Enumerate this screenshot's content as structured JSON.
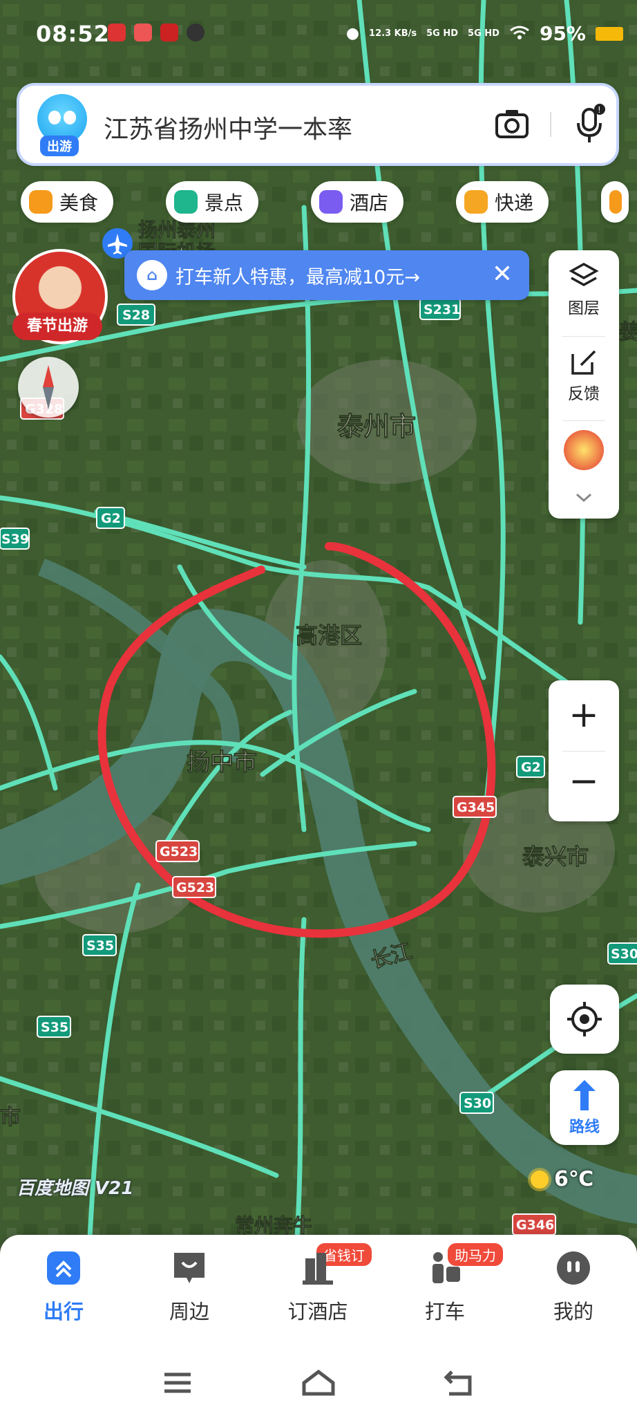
{
  "status_bar": {
    "time": "08:52",
    "network_speed": "12.3 KB/s",
    "net_a": "5G HD",
    "net_b": "5G HD",
    "battery": "95%"
  },
  "search": {
    "badge": "出游",
    "query": "江苏省扬州中学一本率",
    "icons": [
      "camera-icon",
      "microphone-icon"
    ]
  },
  "chips": [
    {
      "label": "美食",
      "color": "#f59a1a"
    },
    {
      "label": "景点",
      "color": "#1fb58d"
    },
    {
      "label": "酒店",
      "color": "#7a5cf0"
    },
    {
      "label": "快递",
      "color": "#f5a623"
    }
  ],
  "avatar": {
    "badge": "春节出游"
  },
  "banner": {
    "text": "打车新人特惠，最高减10元→",
    "icon_text": "🚕"
  },
  "right_panel": {
    "layers": "图层",
    "feedback": "反馈"
  },
  "zoom": {
    "in": "+",
    "out": "−"
  },
  "route": {
    "label": "路线"
  },
  "weather": {
    "temp": "6℃"
  },
  "map": {
    "labels": {
      "airport": "扬州泰州",
      "airport2": "国际机场",
      "taizhou": "泰州市",
      "gaogang": "高港区",
      "yangzhong": "扬中市",
      "taixing": "泰兴市",
      "changjiang": "长江",
      "changzhou": "常州奔牛",
      "edge_right": "姜",
      "edge_left": "市"
    },
    "road_shields": [
      "S28",
      "G328",
      "S231",
      "G2",
      "S39",
      "G2",
      "G345",
      "G523",
      "G523",
      "S35",
      "S35",
      "S30",
      "S30",
      "G346"
    ],
    "watermark": "百度地图 V21"
  },
  "bottom_nav": [
    {
      "label": "出行",
      "active": true
    },
    {
      "label": "周边",
      "active": false
    },
    {
      "label": "订酒店",
      "badge": "省钱订",
      "active": false
    },
    {
      "label": "打车",
      "badge": "助马力",
      "active": false
    },
    {
      "label": "我的",
      "active": false
    }
  ],
  "colors": {
    "accent": "#2f7cf6",
    "road": "#5fe0b9",
    "annotation": "#e8323c",
    "river": "#4f7d6c"
  }
}
